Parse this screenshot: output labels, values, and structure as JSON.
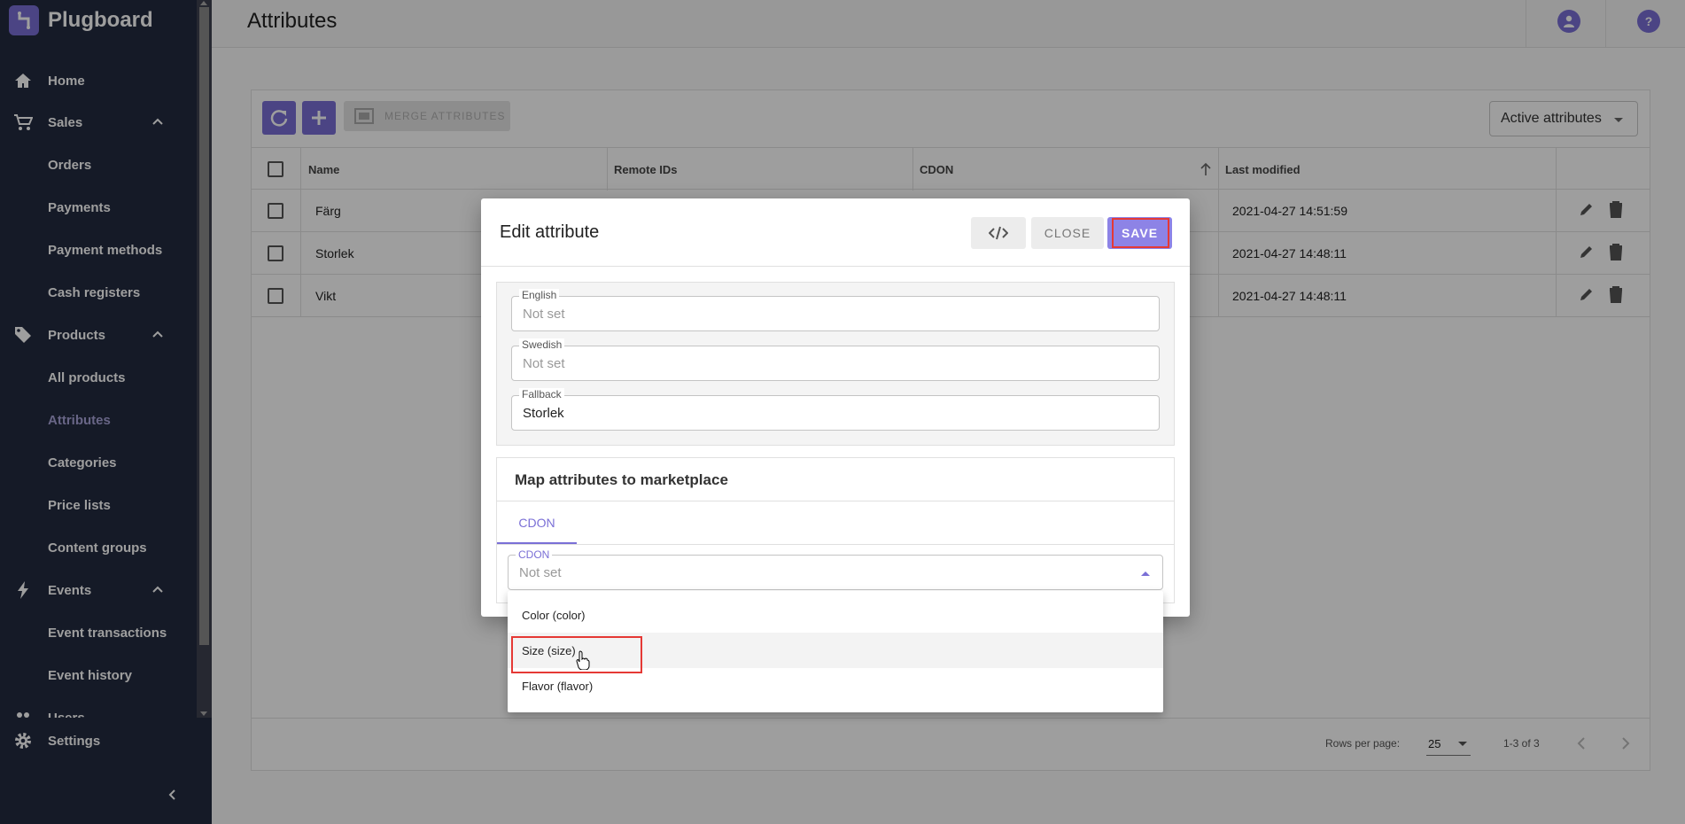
{
  "app": {
    "name": "Plugboard"
  },
  "sidebar": {
    "items": [
      {
        "label": "Home",
        "icon": "home-icon"
      },
      {
        "label": "Sales",
        "icon": "cart-icon"
      },
      {
        "label": "Orders"
      },
      {
        "label": "Payments"
      },
      {
        "label": "Payment methods"
      },
      {
        "label": "Cash registers"
      },
      {
        "label": "Products",
        "icon": "tag-icon"
      },
      {
        "label": "All products"
      },
      {
        "label": "Attributes",
        "active": true
      },
      {
        "label": "Categories"
      },
      {
        "label": "Price lists"
      },
      {
        "label": "Content groups"
      },
      {
        "label": "Events",
        "icon": "bolt-icon"
      },
      {
        "label": "Event transactions"
      },
      {
        "label": "Event history"
      },
      {
        "label": "Users",
        "icon": "users-icon"
      }
    ],
    "settings_label": "Settings"
  },
  "header": {
    "title": "Attributes"
  },
  "toolbar": {
    "merge_label": "MERGE ATTRIBUTES",
    "filter_value": "Active attributes"
  },
  "table": {
    "columns": [
      "Name",
      "Remote IDs",
      "CDON",
      "Last modified"
    ],
    "rows": [
      {
        "name": "Färg",
        "modified": "2021-04-27 14:51:59"
      },
      {
        "name": "Storlek",
        "modified": "2021-04-27 14:48:11"
      },
      {
        "name": "Vikt",
        "modified": "2021-04-27 14:48:11"
      }
    ]
  },
  "pagination": {
    "rows_per_page_label": "Rows per page:",
    "rows_per_page": "25",
    "range": "1-3 of 3"
  },
  "dialog": {
    "title": "Edit attribute",
    "close_label": "CLOSE",
    "save_label": "SAVE",
    "fields": [
      {
        "label": "English",
        "value": "Not set"
      },
      {
        "label": "Swedish",
        "value": "Not set"
      },
      {
        "label": "Fallback",
        "value": "Storlek"
      }
    ],
    "map_title": "Map attributes to marketplace",
    "tab_label": "CDON",
    "select_label": "CDON",
    "select_value": "Not set"
  },
  "dropdown": {
    "options": [
      "Color (color)",
      "Size (size)",
      "Flavor (flavor)"
    ]
  },
  "colors": {
    "accent": "#7a6fd6",
    "sidebar": "#222a3f",
    "highlight": "#e53935"
  }
}
